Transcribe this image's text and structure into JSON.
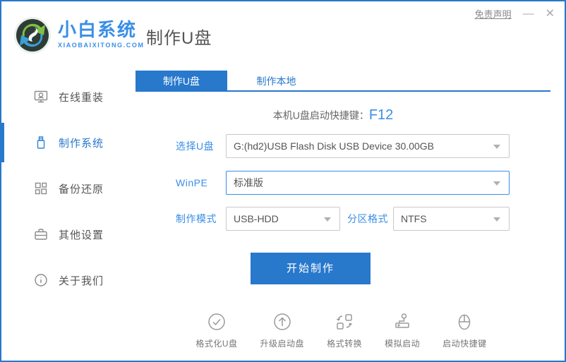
{
  "titlebar": {
    "logo_title": "小白系统",
    "logo_subtitle": "XIAOBAIXITONG.COM",
    "page_title": "制作U盘",
    "disclaimer_link": "免责声明",
    "minimize_glyph": "—",
    "close_glyph": "✕"
  },
  "colors": {
    "primary_blue": "#2878cc",
    "label_blue": "#3a8ee6",
    "text_gray": "#555555",
    "icon_gray": "#9a9a9a"
  },
  "sidebar": {
    "items": [
      {
        "label": "在线重装",
        "icon": "online-reinstall-icon",
        "active": false
      },
      {
        "label": "制作系统",
        "icon": "make-system-usb-icon",
        "active": true
      },
      {
        "label": "备份还原",
        "icon": "backup-restore-icon",
        "active": false
      },
      {
        "label": "其他设置",
        "icon": "other-settings-icon",
        "active": false
      },
      {
        "label": "关于我们",
        "icon": "about-us-icon",
        "active": false
      }
    ]
  },
  "main": {
    "tabs": [
      {
        "label": "制作U盘",
        "active": true
      },
      {
        "label": "制作本地",
        "active": false
      }
    ],
    "hotkey": {
      "label": "本机U盘启动快捷键：",
      "value": "F12"
    },
    "form": {
      "usb_select": {
        "label": "选择U盘",
        "value": "G:(hd2)USB Flash Disk USB Device 30.00GB"
      },
      "winpe_select": {
        "label": "WinPE",
        "value": "标准版"
      },
      "mode_select": {
        "label": "制作模式",
        "value": "USB-HDD"
      },
      "partition_select": {
        "label": "分区格式",
        "value": "NTFS"
      }
    },
    "start_button": "开始制作",
    "tools": [
      {
        "label": "格式化U盘",
        "icon": "format-usb-icon"
      },
      {
        "label": "升级启动盘",
        "icon": "upgrade-bootdisk-icon"
      },
      {
        "label": "格式转换",
        "icon": "format-convert-icon"
      },
      {
        "label": "模拟启动",
        "icon": "simulate-boot-icon"
      },
      {
        "label": "启动快捷键",
        "icon": "boot-hotkey-icon"
      }
    ]
  }
}
